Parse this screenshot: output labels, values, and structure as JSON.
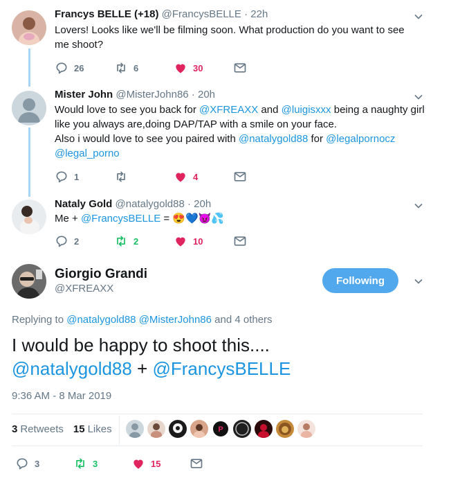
{
  "tweets": [
    {
      "name": "Francys BELLE (+18)",
      "handle": "@FrancysBELLE",
      "time": "· 22h",
      "text_line1": "Lovers! Looks like we'll be filming soon. What production do you want to see",
      "text_line2": "me shoot?",
      "replies": "26",
      "retweets": "6",
      "likes": "30"
    },
    {
      "name": "Mister John",
      "handle": "@MisterJohn86",
      "time": "· 20h",
      "l1_a": "Would love to see you back for ",
      "l1_link1": "@XFREAXX",
      "l1_b": " and ",
      "l1_link2": "@luigisxxx",
      "l1_c": " being a naughty girl",
      "l2": "like you always are,doing DAP/TAP with a smile on your face.",
      "l3_a": "Also i would love to see you paired with ",
      "l3_link1": "@natalygold88",
      "l3_b": " for ",
      "l3_link2": "@legalpornocz",
      "l4_link": "@legal_porno",
      "replies": "1",
      "retweets": "",
      "likes": "4"
    },
    {
      "name": "Nataly Gold",
      "handle": "@natalygold88",
      "time": "· 20h",
      "text_a": "Me + ",
      "text_link": "@FrancysBELLE",
      "text_b": " = ",
      "emoji": "😍💙😈💦",
      "replies": "2",
      "retweets": "2",
      "likes": "10"
    }
  ],
  "main_tweet": {
    "name": "Giorgio Grandi",
    "handle": "@XFREAXX",
    "follow_label": "Following",
    "replying_prefix": "Replying to ",
    "replying_link1": "@natalygold88",
    "replying_sep": " ",
    "replying_link2": "@MisterJohn86",
    "replying_suffix": " and 4 others",
    "line1": "I would be happy to shoot this....",
    "line2_link1": "@natalygold88",
    "line2_plus": " + ",
    "line2_link2": "@FrancysBELLE",
    "timestamp": "9:36 AM - 8 Mar 2019",
    "retweets_count": "3",
    "retweets_label": "Retweets",
    "likes_count": "15",
    "likes_label": "Likes",
    "replies": "3",
    "retweets": "3",
    "likes": "15"
  },
  "colors": {
    "link": "#1b95e0",
    "retweet_active": "#17bf63",
    "like_active": "#e0245e",
    "follow_button": "#51a8ec",
    "thread_line": "#a9d5f5"
  },
  "icons": [
    "reply-icon",
    "retweet-icon",
    "like-icon",
    "dm-icon",
    "chevron-down-icon"
  ]
}
